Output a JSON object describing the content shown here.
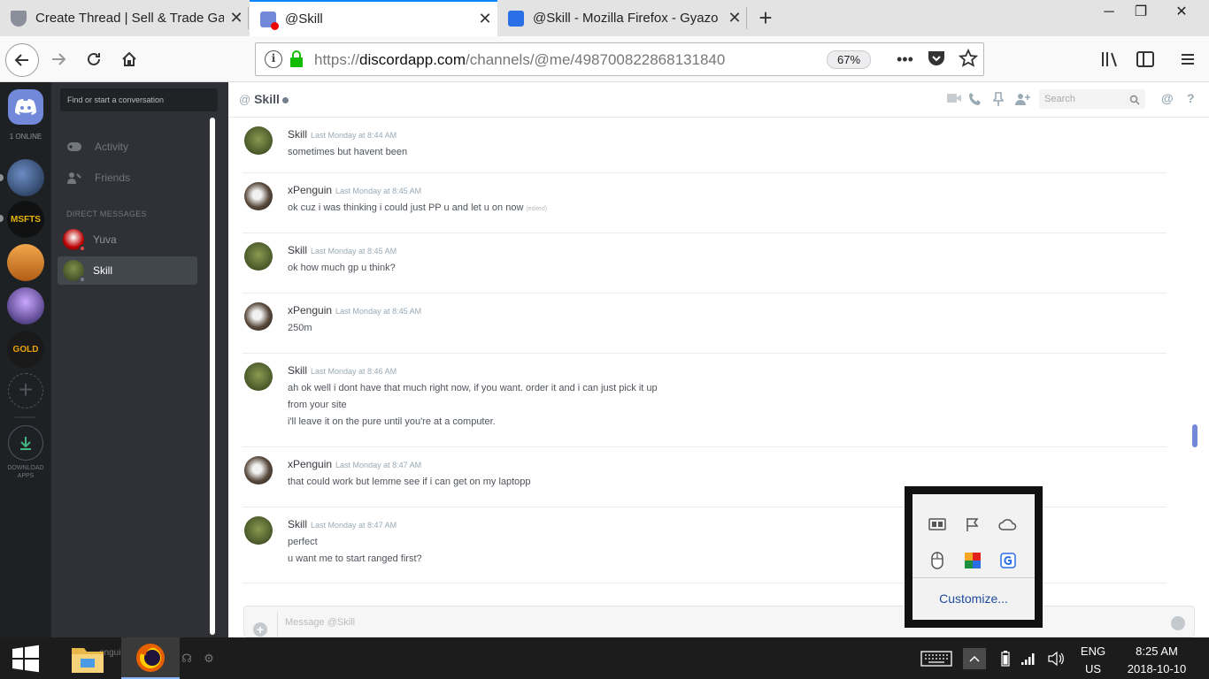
{
  "browser": {
    "tabs": [
      {
        "title": "Create Thread | Sell & Trade Ga",
        "favicon": "shield-icon",
        "active": false
      },
      {
        "title": "@Skill",
        "favicon": "discord-icon",
        "active": true
      },
      {
        "title": "@Skill - Mozilla Firefox - Gyazo",
        "favicon": "gyazo-icon",
        "active": false
      }
    ],
    "new_tab_label": "+",
    "url_prefix": "https://",
    "url_host": "discordapp.com",
    "url_path": "/channels/@me/498700822868131840",
    "zoom": "67%"
  },
  "discord": {
    "guild_online": "1 ONLINE",
    "download_label": "DOWNLOAD APPS",
    "dm_search_placeholder": "Find or start a conversation",
    "nav": {
      "activity": "Activity",
      "friends": "Friends"
    },
    "dm_header": "DIRECT MESSAGES",
    "dm_list": [
      {
        "name": "Yuva",
        "status_color": "#f04747",
        "selected": false
      },
      {
        "name": "Skill",
        "status_color": "#747f8d",
        "selected": true
      }
    ],
    "channel": {
      "prefix": "@",
      "name": "Skill",
      "search_placeholder": "Search"
    },
    "messages": [
      {
        "author": "Skill",
        "time": "Last Monday at 8:44 AM",
        "lines": [
          "sometimes but havent been"
        ],
        "edited": ""
      },
      {
        "author": "xPenguin",
        "time": "Last Monday at 8:45 AM",
        "lines": [
          "ok cuz i was thinking i could just PP u and let u on now"
        ],
        "edited": "(edited)"
      },
      {
        "author": "Skill",
        "time": "Last Monday at 8:45 AM",
        "lines": [
          "ok how much gp u think?"
        ],
        "edited": ""
      },
      {
        "author": "xPenguin",
        "time": "Last Monday at 8:45 AM",
        "lines": [
          "250m"
        ],
        "edited": ""
      },
      {
        "author": "Skill",
        "time": "Last Monday at 8:46 AM",
        "lines": [
          "ah ok well i dont have that much right now, if you want. order it and i can just pick it up",
          "from your site",
          "i'll leave it on the pure until you're at a computer."
        ],
        "edited": ""
      },
      {
        "author": "xPenguin",
        "time": "Last Monday at 8:47 AM",
        "lines": [
          "that could work but lemme see if i can get on my laptopp"
        ],
        "edited": ""
      },
      {
        "author": "Skill",
        "time": "Last Monday at 8:47 AM",
        "lines": [
          "perfect",
          "u want me to start ranged first?"
        ],
        "edited": ""
      }
    ],
    "composer_placeholder": "Message @Skill",
    "taskbar_user_fragment": "enguin",
    "accent": "#7289da"
  },
  "tray_popup": {
    "customize_label": "Customize..."
  },
  "taskbar": {
    "lang_top": "ENG",
    "lang_bottom": "US",
    "time": "8:25 AM",
    "date": "2018-10-10"
  }
}
